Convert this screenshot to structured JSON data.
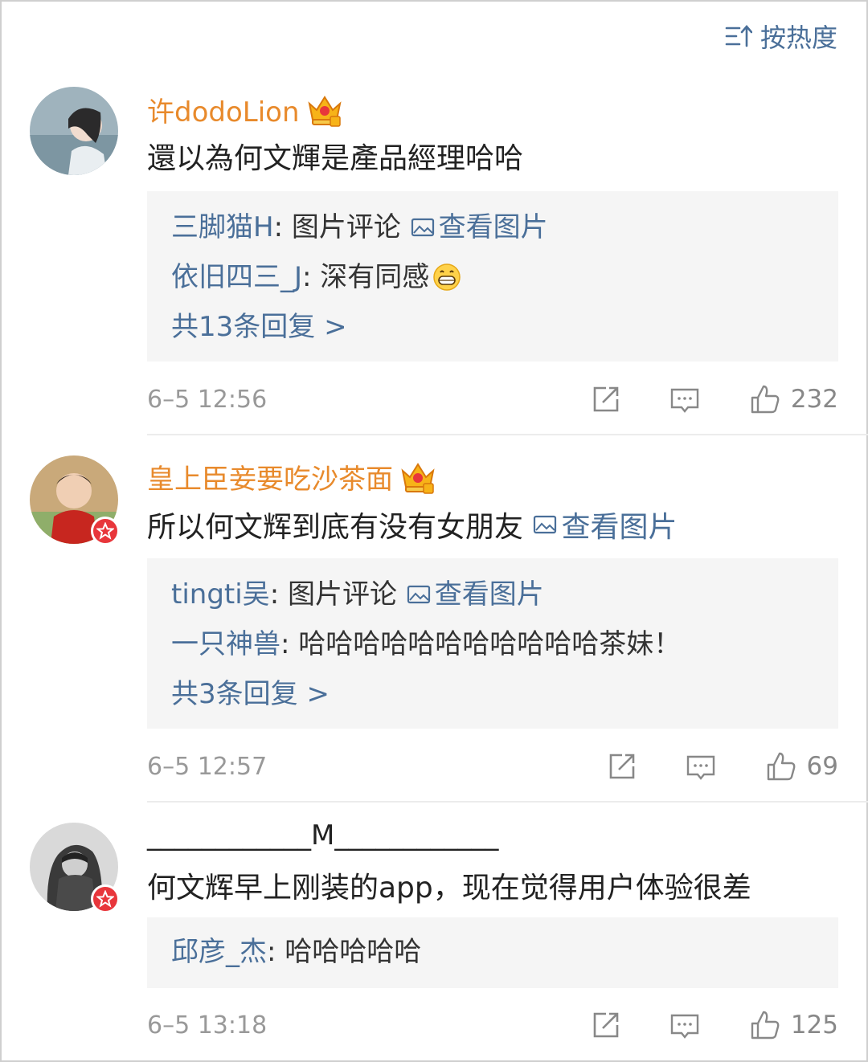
{
  "sort": {
    "label": "按热度"
  },
  "comments": [
    {
      "username": "许dodoLion",
      "text": "還以為何文輝是產品經理哈哈",
      "replies": [
        {
          "user": "三脚猫H",
          "text": "图片评论",
          "link": "查看图片"
        },
        {
          "user": "依旧四三_J",
          "text": "深有同感"
        }
      ],
      "more": "共13条回复 >",
      "time": "6–5 12:56",
      "likes": "232"
    },
    {
      "username": "皇上臣妾要吃沙茶面",
      "text": "所以何文辉到底有没有女朋友",
      "link": "查看图片",
      "replies": [
        {
          "user": "tingti吴",
          "text": "图片评论",
          "link": "查看图片"
        },
        {
          "user": "一只神兽",
          "text": "哈哈哈哈哈哈哈哈哈哈哈茶妹！"
        }
      ],
      "more": "共3条回复 >",
      "time": "6–5 12:57",
      "likes": "69"
    },
    {
      "username": "____________M____________",
      "text": "何文辉早上刚装的app，现在觉得用户体验很差",
      "replies": [
        {
          "user": "邱彦_杰",
          "text": "哈哈哈哈哈"
        }
      ],
      "time": "6–5 13:18",
      "likes": "125"
    }
  ],
  "colors": {
    "link": "#4a6f99",
    "username": "#e88a2c",
    "reply_bg": "#f5f5f5",
    "meta": "#999999"
  }
}
